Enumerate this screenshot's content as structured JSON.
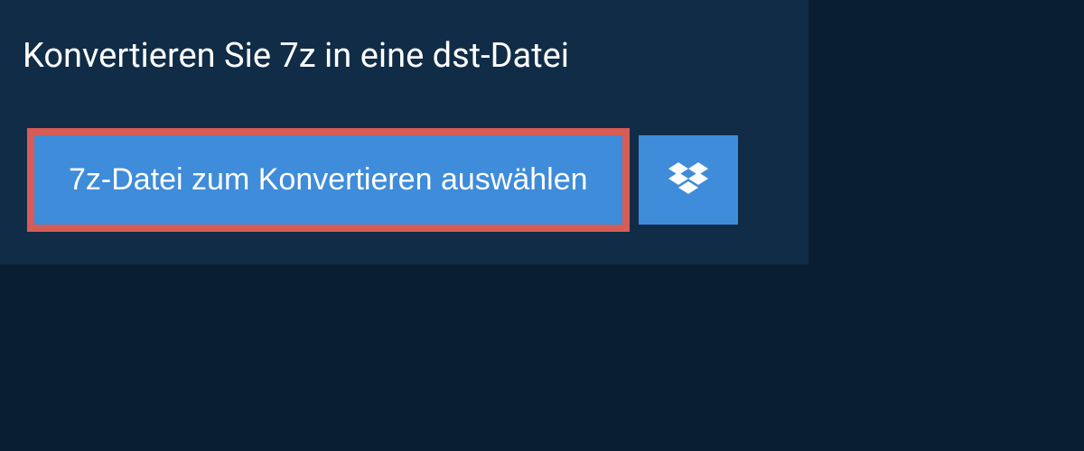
{
  "title": "Konvertieren Sie 7z in eine dst-Datei",
  "select_button_label": "7z-Datei zum Konvertieren auswählen",
  "colors": {
    "background": "#0a1e33",
    "panel": "#102c47",
    "button": "#3e8cda",
    "highlight_border": "#d85c56"
  }
}
